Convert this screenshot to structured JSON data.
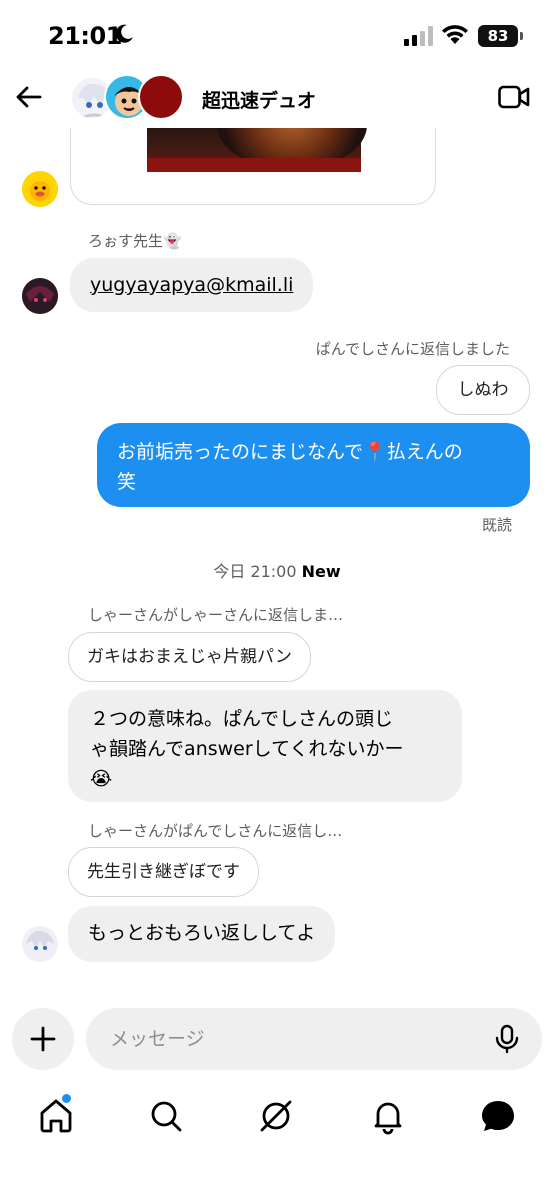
{
  "status_bar": {
    "time": "21:01",
    "battery": "83"
  },
  "header": {
    "title": "超迅速デュオ"
  },
  "messages": [
    {
      "sender": "ろぉす先生👻",
      "text": "yugyayapya@kmail.li"
    },
    {
      "reply_note": "ぱんでしさんに返信しました",
      "quoted": "しぬわ",
      "text_line1": "お前垢売ったのにまじなんで📍払えんの",
      "text_line2": "笑",
      "read": "既読"
    },
    {
      "reply_note": "しゃーさんがしゃーさんに返信しま…",
      "quoted": "ガキはおまえじゃ片親パン"
    },
    {
      "text_line1": "２つの意味ね。ぱんでしさんの頭じ",
      "text_line2": "ゃ韻踏んでanswerしてくれないかー",
      "text_line3": "😭"
    },
    {
      "reply_note": "しゃーさんがぱんでしさんに返信し…",
      "quoted": "先生引き継ぎぼです",
      "text": "もっとおもろい返ししてよ"
    }
  ],
  "time_separator": {
    "time": "今日 21:00",
    "badge": "New"
  },
  "composer": {
    "placeholder": "メッセージ"
  },
  "colors": {
    "accent_blue": "#1d8ff1",
    "bubble_gray": "#efefef",
    "muted_text": "#5e5e5e"
  },
  "icons": [
    "back-arrow-icon",
    "video-call-icon",
    "plus-icon",
    "microphone-icon",
    "home-icon",
    "search-icon",
    "explore-icon",
    "notifications-icon",
    "messages-icon"
  ]
}
